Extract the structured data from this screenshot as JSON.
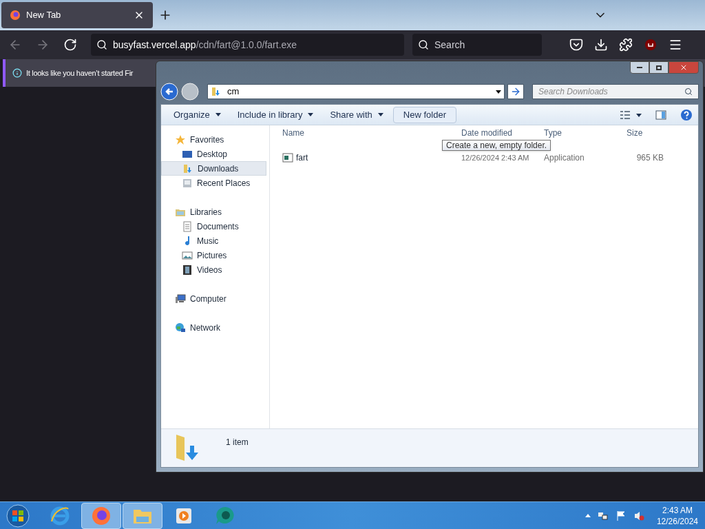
{
  "browser": {
    "tabs": [
      {
        "title": "New Tab",
        "selected": true
      }
    ],
    "address": {
      "host": "busyfast.vercel.app",
      "path": "/cdn/fart@1.0.0/fart.exe"
    },
    "search": {
      "placeholder": "Search"
    },
    "notification": "It looks like you haven’t started Fir"
  },
  "explorer": {
    "address": {
      "value": "cm"
    },
    "search": {
      "placeholder": "Search Downloads"
    },
    "toolbar": [
      {
        "label": "Organize",
        "kind": "menu"
      },
      {
        "label": "Include in library",
        "kind": "menu"
      },
      {
        "label": "Share with",
        "kind": "menu"
      },
      {
        "label": "New folder",
        "kind": "button"
      }
    ],
    "tooltip": "Create a new, empty folder.",
    "nav": [
      {
        "label": "Favorites",
        "kind": "star",
        "children": [
          {
            "label": "Desktop",
            "kind": "desktop",
            "selected": false
          },
          {
            "label": "Downloads",
            "kind": "downloads",
            "selected": true
          },
          {
            "label": "Recent Places",
            "kind": "recent",
            "selected": false
          }
        ]
      },
      {
        "label": "Libraries",
        "kind": "libraries",
        "children": [
          {
            "label": "Documents",
            "kind": "documents",
            "selected": false
          },
          {
            "label": "Music",
            "kind": "music",
            "selected": false
          },
          {
            "label": "Pictures",
            "kind": "pictures",
            "selected": false
          },
          {
            "label": "Videos",
            "kind": "videos",
            "selected": false
          }
        ]
      },
      {
        "label": "Computer",
        "kind": "computer"
      },
      {
        "label": "Network",
        "kind": "network"
      }
    ],
    "columns": [
      "Name",
      "Date modified",
      "Type",
      "Size"
    ],
    "rows": [
      {
        "name": "fart",
        "date": "12/26/2024 2:43 AM",
        "type": "Application",
        "size": "965 KB"
      }
    ],
    "status": "1 item"
  },
  "taskbar": {
    "apps": [
      {
        "kind": "ie",
        "active": false
      },
      {
        "kind": "firefox",
        "active": true
      },
      {
        "kind": "explorer",
        "active": true
      },
      {
        "kind": "media",
        "active": false
      },
      {
        "kind": "bubble",
        "active": false
      }
    ],
    "time": "2:43 AM",
    "date": "12/26/2024"
  }
}
